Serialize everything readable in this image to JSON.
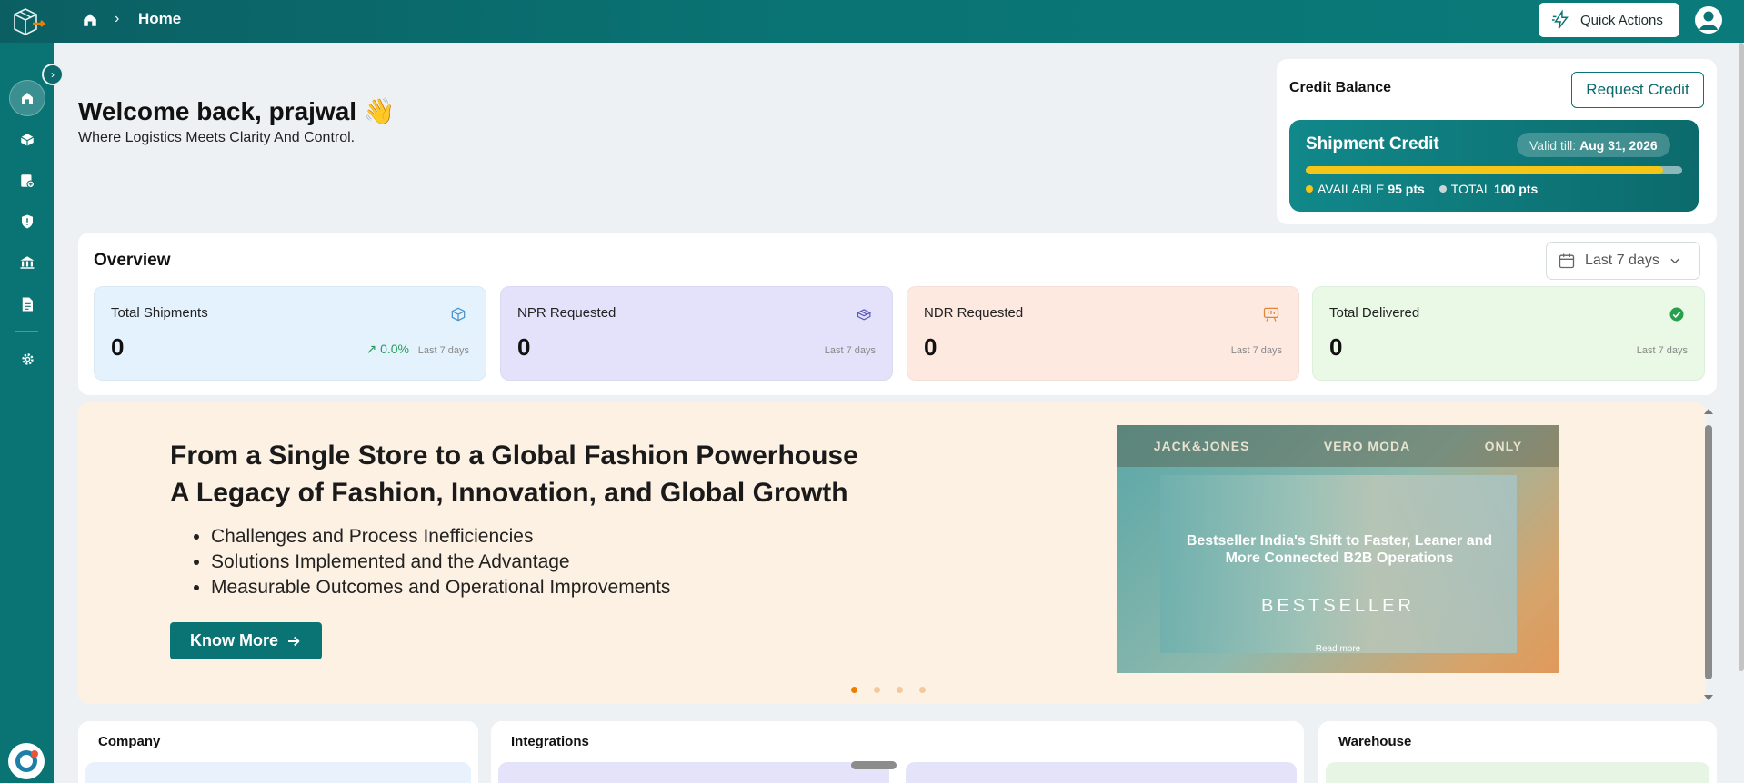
{
  "header": {
    "breadcrumb_title": "Home",
    "breadcrumb_separator": "›",
    "quick_actions_label": "Quick Actions"
  },
  "sidebar": {
    "items": [
      {
        "icon": "home-icon",
        "active": true
      },
      {
        "icon": "box-icon",
        "active": false
      },
      {
        "icon": "add-document-icon",
        "active": false
      },
      {
        "icon": "alert-shield-icon",
        "active": false
      },
      {
        "icon": "bank-icon",
        "active": false
      },
      {
        "icon": "report-icon",
        "active": false
      },
      {
        "icon": "gear-icon",
        "active": false
      }
    ]
  },
  "welcome": {
    "title": "Welcome back, prajwal 👋",
    "subtitle": "Where Logistics Meets Clarity And Control."
  },
  "credit": {
    "title": "Credit Balance",
    "request_label": "Request Credit",
    "shipment_title": "Shipment Credit",
    "valid_prefix": "Valid till:",
    "valid_date": "Aug 31, 2026",
    "available_label": "AVAILABLE",
    "available_value": "95 pts",
    "total_label": "TOTAL",
    "total_value": "100 pts",
    "used_fraction": 0.95,
    "colors": {
      "available": "#f5c518",
      "total": "#c8d6d6"
    }
  },
  "overview": {
    "title": "Overview",
    "range": "Last 7 days",
    "stats": [
      {
        "label": "Total Shipments",
        "value": "0",
        "trend": "0.0%",
        "period": "Last 7 days",
        "bg": "#e3f2fd",
        "icon": "cube-icon"
      },
      {
        "label": "NPR Requested",
        "value": "0",
        "trend": "",
        "period": "Last 7 days",
        "bg": "#e4e2fb",
        "icon": "boxes-icon"
      },
      {
        "label": "NDR Requested",
        "value": "0",
        "trend": "",
        "period": "Last 7 days",
        "bg": "#fde9e0",
        "icon": "presentation-icon"
      },
      {
        "label": "Total Delivered",
        "value": "0",
        "trend": "",
        "period": "Last 7 days",
        "bg": "#e9f9e6",
        "icon": "check-circle-icon"
      }
    ]
  },
  "banner": {
    "headline1": "From a Single Store to a Global Fashion Powerhouse",
    "headline2": "A Legacy of Fashion, Innovation, and Global Growth",
    "bullets": [
      "Challenges and Process Inefficiencies",
      "Solutions Implemented and the Advantage",
      "Measurable Outcomes and Operational Improvements"
    ],
    "cta": "Know More",
    "promo": {
      "brands": [
        "JACK&JONES",
        "VERO MODA",
        "ONLY"
      ],
      "text": "Bestseller India's Shift to Faster, Leaner and More Connected B2B Operations",
      "brand": "BESTSELLER",
      "read_more": "Read more"
    },
    "slides": 4,
    "active_slide": 0
  },
  "bottom_cards": {
    "company": "Company",
    "integrations": "Integrations",
    "warehouse": "Warehouse"
  }
}
